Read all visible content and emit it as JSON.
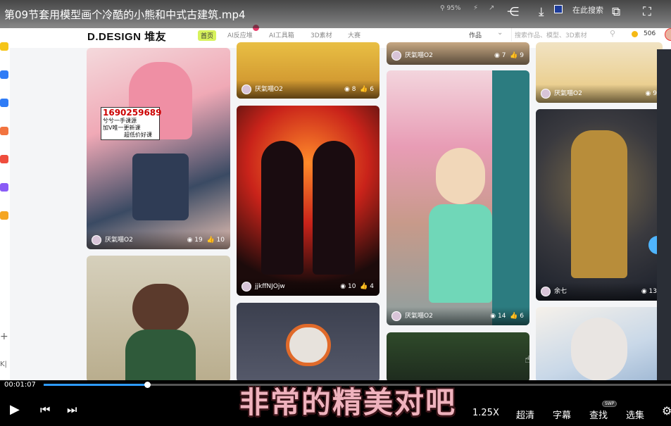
{
  "video": {
    "title": "第09节套用模型画个冷酷的小熊和中式古建筑.mp4",
    "current_time": "00:01:07",
    "progress": 0.165,
    "subtitle": "非常的精美对吧"
  },
  "topbar": {
    "zoom": "95%",
    "search_placeholder": "在此搜索"
  },
  "controls": {
    "speed": "1.25X",
    "quality": "超清",
    "captions": "字幕",
    "search": "查找",
    "search_badge": "SWP",
    "episodes": "选集"
  },
  "site": {
    "logo": "D.DESIGN 堆友",
    "nav": [
      {
        "label": "首页",
        "active": true
      },
      {
        "label": "AI反应堆"
      },
      {
        "label": "AI工具箱"
      },
      {
        "label": "3D素材"
      },
      {
        "label": "大赛"
      }
    ],
    "works_dropdown": "作品",
    "search_placeholder": "搜索作品、模型、3D素材",
    "coins": "506"
  },
  "watermark": {
    "number": "1690259689",
    "line1": "兮兮一手课源",
    "line2": "加V唯一更新课",
    "line3": "超低价好课"
  },
  "cards": [
    {
      "author": "厌氣喵O2",
      "views": "19",
      "likes": "10"
    },
    {
      "author": "厌氣喵O2",
      "views": "8",
      "likes": "6"
    },
    {
      "author": "jjkffNJOjw",
      "views": "10",
      "likes": "4"
    },
    {
      "author": "厌氣喵O2",
      "views": "7",
      "likes": "9"
    },
    {
      "author": "厌氣喵O2",
      "views": "14",
      "likes": "6"
    },
    {
      "author": "厌氣喵O2",
      "views": "9",
      "likes": ""
    },
    {
      "author": "余七",
      "views": "13",
      "likes": ""
    }
  ],
  "colors": {
    "progress": "#2e9bff",
    "nav_active": "#d7f25c",
    "subtitle": "#efb2bd"
  }
}
